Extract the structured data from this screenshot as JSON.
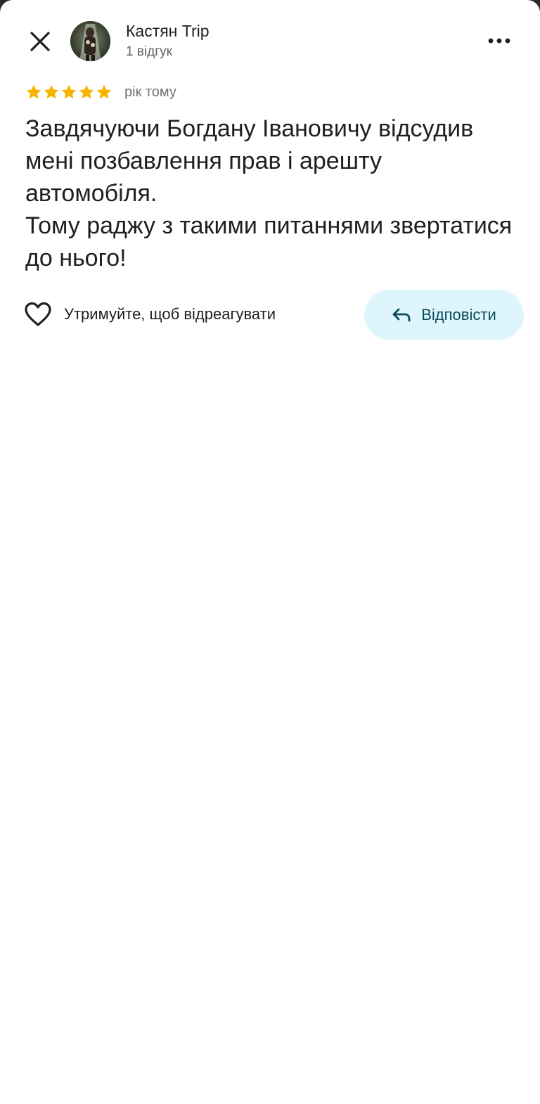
{
  "header": {
    "close_icon": "close-icon",
    "more_icon": "more-horizontal-icon"
  },
  "author": {
    "name": "Кастян Trip",
    "meta": "1 відгук",
    "avatar": "avatar-photo"
  },
  "review": {
    "rating": 5,
    "rating_max": 5,
    "star_color": "#f4b400",
    "date": "рік тому",
    "text": "Завдячуючи Богдану Івановичу відсудив мені позбавлення прав і арешту автомобіля.\nТому раджу з такими питаннями звертатися до нього!"
  },
  "actions": {
    "like_icon": "heart-outline-icon",
    "like_label": "Утримуйте, щоб відреагувати",
    "reply_icon": "reply-arrow-icon",
    "reply_label": "Відповісти",
    "reply_bg_color": "#dff5fc",
    "reply_text_color": "#0b4a5a"
  }
}
